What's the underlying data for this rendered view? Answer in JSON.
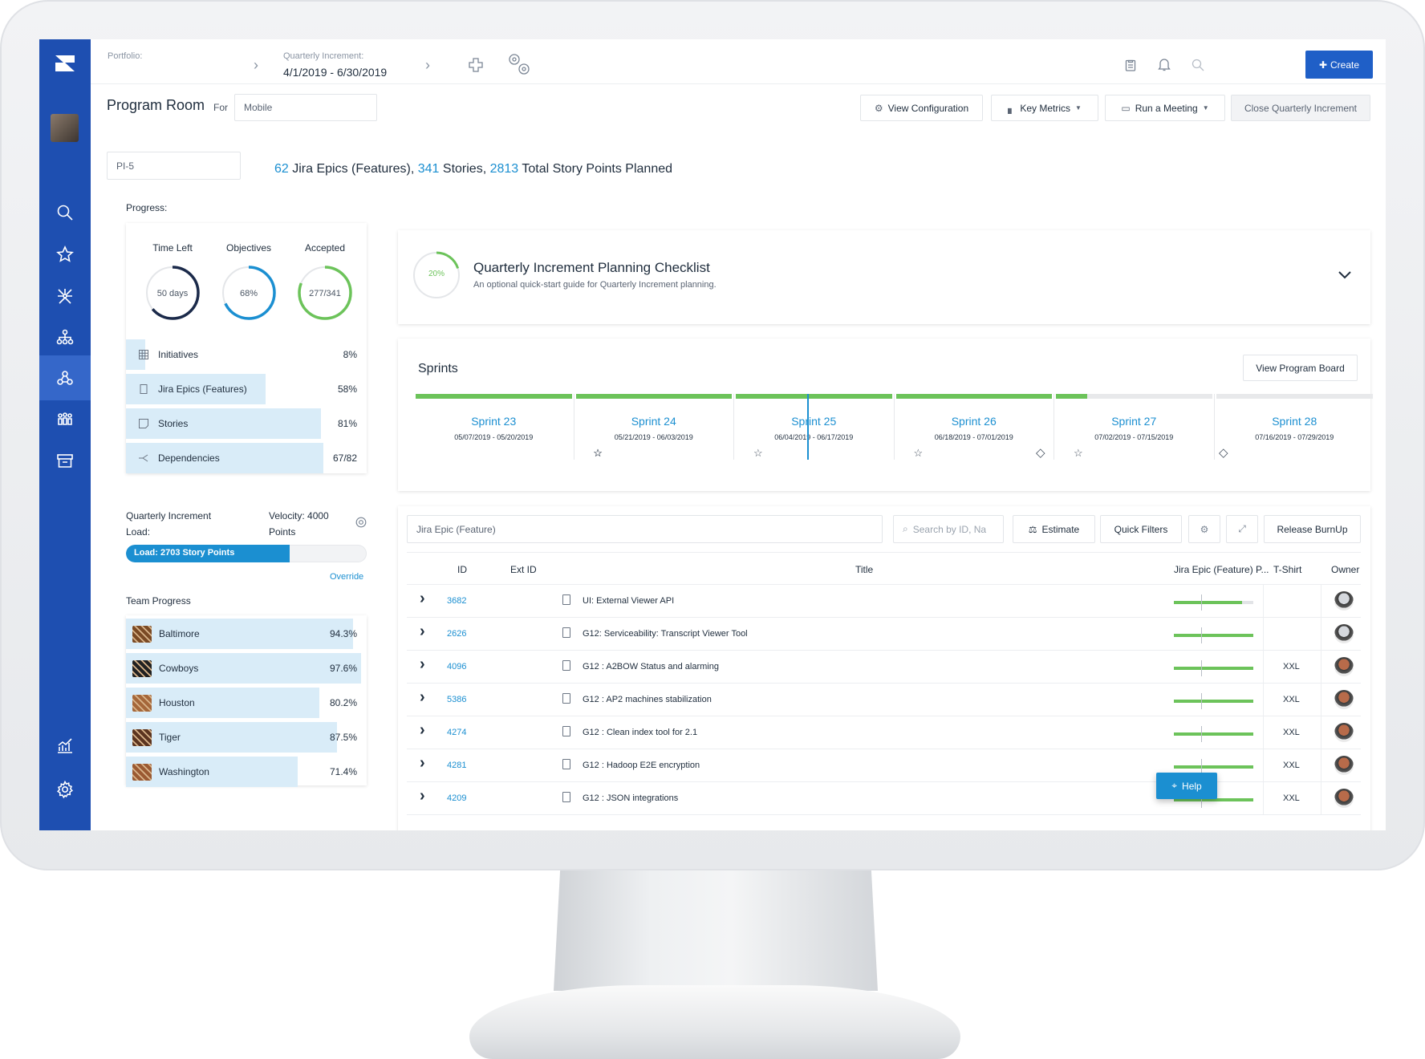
{
  "topbar": {
    "portfolio_label": "Portfolio:",
    "qi_label": "Quarterly Increment:",
    "qi_value": "4/1/2019 - 6/30/2019",
    "create_label": "Create"
  },
  "header": {
    "title": "Program Room",
    "for_label": "For",
    "for_value": "Mobile",
    "buttons": {
      "view_configuration": "View Configuration",
      "key_metrics": "Key Metrics",
      "run_meeting": "Run a Meeting",
      "close_qi": "Close Quarterly Increment"
    }
  },
  "pi": {
    "value": "PI-5"
  },
  "summary": {
    "epics_count": "62",
    "epics_label": "Jira Epics (Features),",
    "stories_count": "341",
    "stories_label": "Stories,",
    "points_count": "2813",
    "points_label": "Total Story Points Planned"
  },
  "progress": {
    "label": "Progress:",
    "rings": [
      {
        "title": "Time Left",
        "value": "50 days",
        "fraction": 0.64,
        "color": "#1b2a4a"
      },
      {
        "title": "Objectives",
        "value": "68%",
        "fraction": 0.68,
        "color": "#1b8fd1"
      },
      {
        "title": "Accepted",
        "value": "277/341",
        "fraction": 0.81,
        "color": "#6cc35a"
      }
    ],
    "rows": [
      {
        "label": "Initiatives",
        "value": "8%",
        "fraction": 0.08,
        "icon": "grid-icon"
      },
      {
        "label": "Jira Epics (Features)",
        "value": "58%",
        "fraction": 0.58,
        "icon": "doc-icon"
      },
      {
        "label": "Stories",
        "value": "81%",
        "fraction": 0.81,
        "icon": "note-icon"
      },
      {
        "label": "Dependencies",
        "value": "67/82",
        "fraction": 0.82,
        "icon": "dependency-icon"
      }
    ]
  },
  "load": {
    "label": "Quarterly Increment Load:",
    "velocity": "Velocity: 4000 Points",
    "bar_label": "Load: 2703 Story Points",
    "fraction": 0.68,
    "override": "Override"
  },
  "teams": {
    "label": "Team Progress",
    "items": [
      {
        "name": "Baltimore",
        "value": "94.3%",
        "fraction": 0.943,
        "swatch": "#7a4a25"
      },
      {
        "name": "Cowboys",
        "value": "97.6%",
        "fraction": 0.976,
        "swatch": "#222222"
      },
      {
        "name": "Houston",
        "value": "80.2%",
        "fraction": 0.802,
        "swatch": "#a5673a"
      },
      {
        "name": "Tiger",
        "value": "87.5%",
        "fraction": 0.875,
        "swatch": "#5c3520"
      },
      {
        "name": "Washington",
        "value": "71.4%",
        "fraction": 0.714,
        "swatch": "#9b5a32"
      }
    ]
  },
  "checklist": {
    "percent": "20%",
    "fraction": 0.2,
    "title": "Quarterly Increment Planning Checklist",
    "subtitle": "An optional quick-start guide for Quarterly Increment planning."
  },
  "sprints": {
    "title": "Sprints",
    "view_board": "View Program Board",
    "items": [
      {
        "name": "Sprint 23",
        "dates": "05/07/2019 - 05/20/2019",
        "fill": 1.0
      },
      {
        "name": "Sprint 24",
        "dates": "05/21/2019 - 06/03/2019",
        "fill": 1.0
      },
      {
        "name": "Sprint 25",
        "dates": "06/04/2019 - 06/17/2019",
        "fill": 1.0
      },
      {
        "name": "Sprint 26",
        "dates": "06/18/2019 - 07/01/2019",
        "fill": 1.0
      },
      {
        "name": "Sprint 27",
        "dates": "07/02/2019 - 07/15/2019",
        "fill": 0.2
      },
      {
        "name": "Sprint 28",
        "dates": "07/16/2019 - 07/29/2019",
        "fill": 0.0
      }
    ]
  },
  "table": {
    "type_select": "Jira Epic (Feature)",
    "search_placeholder": "Search by ID, Na",
    "estimate": "Estimate",
    "quick_filters": "Quick Filters",
    "release_burnup": "Release BurnUp",
    "columns": {
      "id": "ID",
      "ext_id": "Ext ID",
      "title": "Title",
      "progress": "Jira Epic (Feature) P...",
      "tshirt": "T-Shirt",
      "owner": "Owner"
    },
    "rows": [
      {
        "id": "3682",
        "title": "UI: External Viewer API",
        "progress": 0.86,
        "size": ""
      },
      {
        "id": "2626",
        "title": "G12: Serviceability: Transcript Viewer Tool",
        "progress": 1.0,
        "size": ""
      },
      {
        "id": "4096",
        "title": "G12 : A2BOW Status and alarming",
        "progress": 1.0,
        "size": "XXL"
      },
      {
        "id": "5386",
        "title": "G12 : AP2 machines stabilization",
        "progress": 1.0,
        "size": "XXL"
      },
      {
        "id": "4274",
        "title": "G12 : Clean index tool for 2.1",
        "progress": 1.0,
        "size": "XXL"
      },
      {
        "id": "4281",
        "title": "G12 : Hadoop E2E encryption",
        "progress": 1.0,
        "size": "XXL"
      },
      {
        "id": "4209",
        "title": "G12 : JSON integrations",
        "progress": 1.0,
        "size": "XXL"
      }
    ]
  },
  "help": {
    "label": "Help"
  }
}
